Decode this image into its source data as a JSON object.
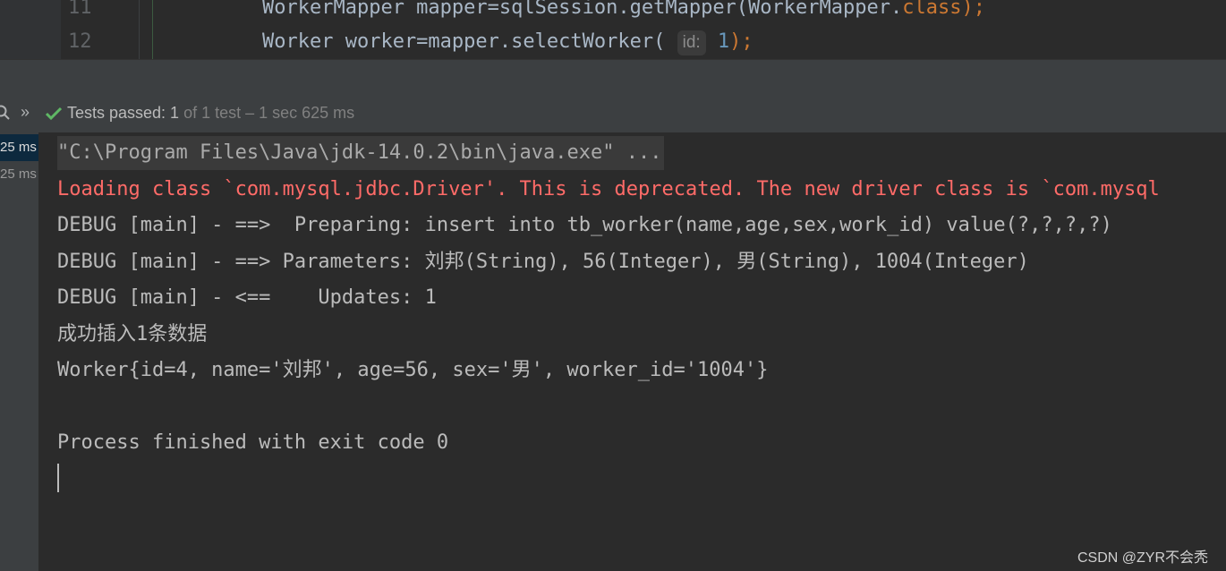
{
  "editor": {
    "lines": [
      {
        "number": "11",
        "code_before": "WorkerMapper mapper=sqlSession.getMapper(WorkerMapper.",
        "keyword": "class",
        "code_after": ");"
      },
      {
        "number": "12",
        "code_before": "Worker worker=mapper.selectWorker( ",
        "hint": "id:",
        "value": "1",
        "code_after": ");"
      }
    ]
  },
  "toolbar": {
    "status_passed": "Tests passed: 1",
    "status_rest": " of 1 test – 1 sec 625 ms",
    "icons": [
      "search-icon",
      "chevron-double-right-icon",
      "check-icon"
    ]
  },
  "tree": {
    "items": [
      {
        "label": "25 ms",
        "selected": true
      },
      {
        "label": "25 ms",
        "selected": false
      }
    ]
  },
  "console": {
    "lines": [
      {
        "text": "\"C:\\Program Files\\Java\\jdk-14.0.2\\bin\\java.exe\" ...",
        "kind": "cmd"
      },
      {
        "text": "Loading class `com.mysql.jdbc.Driver'. This is deprecated. The new driver class is `com.mysql",
        "kind": "err"
      },
      {
        "text": "DEBUG [main] - ==>  Preparing: insert into tb_worker(name,age,sex,work_id) value(?,?,?,?)",
        "kind": "out"
      },
      {
        "text": "DEBUG [main] - ==> Parameters: 刘邦(String), 56(Integer), 男(String), 1004(Integer)",
        "kind": "out"
      },
      {
        "text": "DEBUG [main] - <==    Updates: 1",
        "kind": "out"
      },
      {
        "text": "成功插入1条数据",
        "kind": "out"
      },
      {
        "text": "Worker{id=4, name='刘邦', age=56, sex='男', worker_id='1004'}",
        "kind": "out"
      },
      {
        "text": "Process finished with exit code 0",
        "kind": "out"
      }
    ]
  },
  "watermark": "CSDN @ZYR不会秃",
  "colors": {
    "background": "#2b2b2b",
    "panel": "#3c3f41",
    "error_text": "#ff6b68",
    "pass_green": "#5fb865",
    "keyword": "#cc7832",
    "number": "#6897bb"
  }
}
